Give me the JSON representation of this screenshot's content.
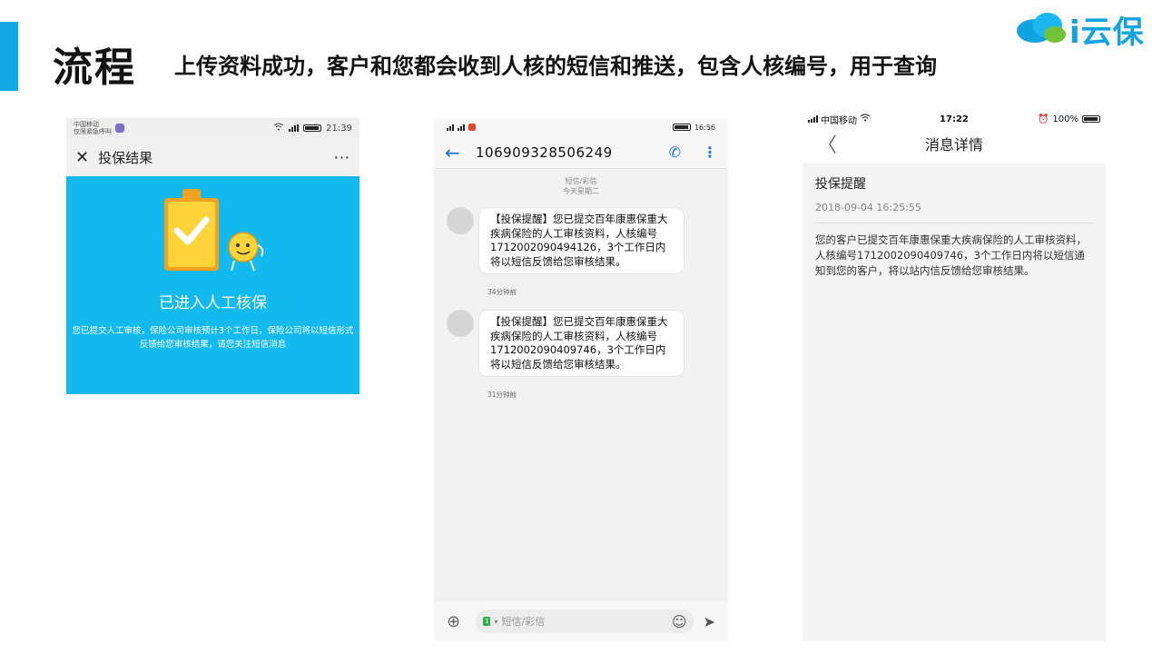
{
  "slide": {
    "title": "流程",
    "subtitle": "上传资料成功，客户和您都会收到人核的短信和推送，包含人核编号，用于查询",
    "logo_text": "i云保",
    "accent_color": "#14a7e6"
  },
  "phone1": {
    "status": {
      "carrier_line1": "中国移动",
      "carrier_line2": "仅限紧急呼叫",
      "time": "21:39"
    },
    "nav": {
      "close": "✕",
      "title": "投保结果",
      "more": "···"
    },
    "banner": {
      "color": "#13baf0",
      "title": "已进入人工核保",
      "description": "您已提交人工审核，保险公司审核预计3个工作日，保险公司将以短信形式反馈给您审核结果，请您关注短信消息"
    }
  },
  "phone2": {
    "status": {
      "time": "16:56"
    },
    "nav": {
      "back": "←",
      "number": "106909328506249",
      "call": "✆",
      "more": "⋮"
    },
    "meta": {
      "type": "短信/彩信",
      "date": "今天星期二"
    },
    "messages": [
      {
        "text": "【投保提醒】您已提交百年康惠保重大疾病保险的人工审核资料，人核编号1712002090494126，3个工作日内将以短信反馈给您审核结果。",
        "time": "34分钟前"
      },
      {
        "text": "【投保提醒】您已提交百年康惠保重大疾病保险的人工审核资料，人核编号1712002090409746，3个工作日内将以短信反馈给您审核结果。",
        "time": "31分钟前"
      }
    ],
    "composer": {
      "plus": "⊕",
      "sim": "1",
      "placeholder": "短信/彩信",
      "emoji": "☺",
      "send": "➤"
    }
  },
  "phone3": {
    "status": {
      "carrier": "中国移动",
      "time": "17:22",
      "battery": "100%"
    },
    "nav": {
      "back": "〈",
      "title": "消息详情"
    },
    "detail": {
      "title": "投保提醒",
      "date": "2018-09-04 16:25:55",
      "body": "您的客户已提交百年康惠保重大疾病保险的人工审核资料，人核编号1712002090409746，3个工作日内将以短信通知到您的客户，将以站内信反馈给您审核结果。"
    }
  }
}
